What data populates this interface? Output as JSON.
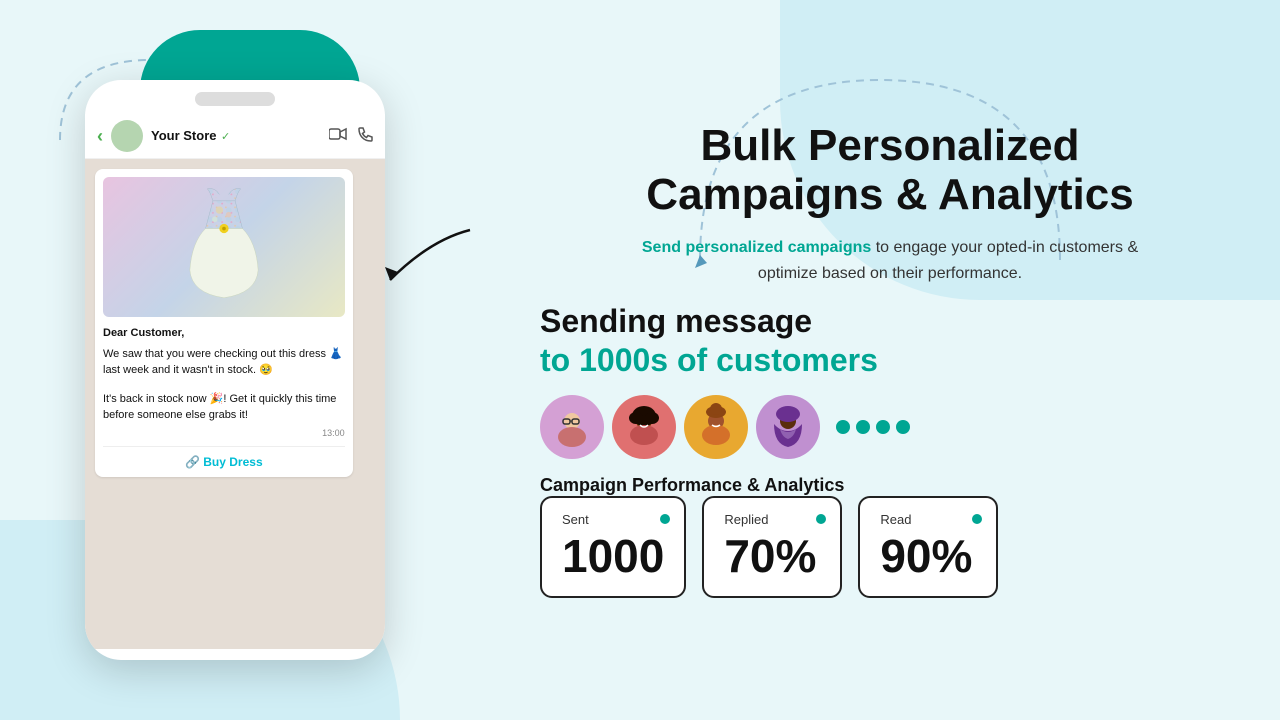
{
  "background": {
    "color": "#e8f7f9"
  },
  "header": {
    "title_line1": "Bulk Personalized",
    "title_line2": "Campaigns & Analytics"
  },
  "subtitle": {
    "highlight": "Send personalized campaigns",
    "rest": " to engage your opted-in customers & optimize based on their performance."
  },
  "sending_section": {
    "line1": "Sending message",
    "line2": "to 1000s of customers"
  },
  "phone": {
    "store_name": "Your Store",
    "verified_icon": "✓",
    "message": {
      "greeting": "Dear Customer,",
      "body1": "We saw that you were checking out this dress 👗 last week and it wasn't in stock. 🥹",
      "body2": "It's back in stock now 🎉! Get it quickly this time before someone else grabs it!",
      "time": "13:00",
      "cta": "Buy Dress"
    }
  },
  "avatars": [
    {
      "id": 1,
      "emoji": "👩‍🦳",
      "bg": "#d4a0d4"
    },
    {
      "id": 2,
      "emoji": "👩🏾",
      "bg": "#e07070"
    },
    {
      "id": 3,
      "emoji": "👩🏽‍🦱",
      "bg": "#e8a830"
    },
    {
      "id": 4,
      "emoji": "🧕🏿",
      "bg": "#c090d0"
    }
  ],
  "analytics": {
    "title": "Campaign Performance & Analytics",
    "cards": [
      {
        "label": "Sent",
        "value": "1000"
      },
      {
        "label": "Replied",
        "value": "70%"
      },
      {
        "label": "Read",
        "value": "90%"
      }
    ]
  },
  "icons": {
    "back": "‹",
    "video": "⬛",
    "phone": "📞",
    "link": "🔗"
  }
}
